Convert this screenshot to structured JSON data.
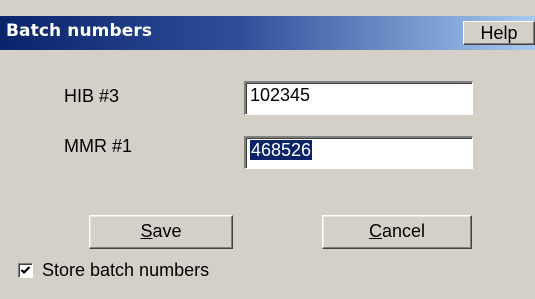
{
  "window": {
    "title": "Batch numbers",
    "help_label": "Help"
  },
  "fields": [
    {
      "label": "HIB  #3",
      "value": "102345",
      "selected": false
    },
    {
      "label": "MMR  #1",
      "value": "468526",
      "selected": true
    }
  ],
  "buttons": {
    "save": {
      "accel": "S",
      "rest": "ave"
    },
    "cancel": {
      "accel": "C",
      "rest": "ancel"
    }
  },
  "store_checkbox": {
    "label": "Store batch numbers",
    "checked": true
  },
  "colors": {
    "titlebar_start": "#0a246a",
    "titlebar_end": "#a6caf0",
    "face": "#d4d0c8",
    "selection": "#0a246a"
  }
}
